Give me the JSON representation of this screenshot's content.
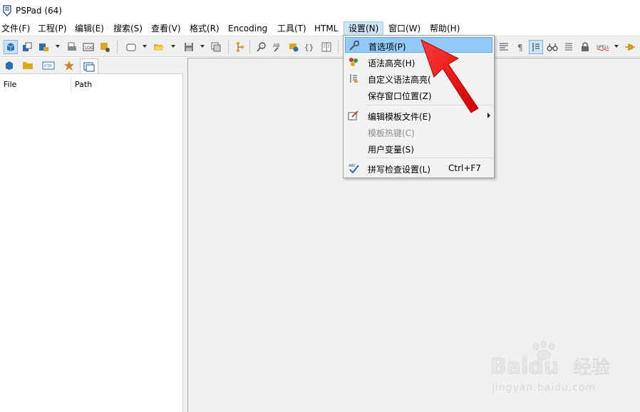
{
  "window": {
    "title": "PSPad (64)"
  },
  "menubar": {
    "items": [
      {
        "label": "文件(F)"
      },
      {
        "label": "工程(P)"
      },
      {
        "label": "编辑(E)"
      },
      {
        "label": "搜索(S)"
      },
      {
        "label": "查看(V)"
      },
      {
        "label": "格式(R)"
      },
      {
        "label": "Encoding"
      },
      {
        "label": "工具(T)"
      },
      {
        "label": "HTML"
      },
      {
        "label": "设置(N)",
        "active": true
      },
      {
        "label": "窗口(W)"
      },
      {
        "label": "帮助(H)"
      }
    ]
  },
  "toolbar": {
    "buttons": [
      "new-project-icon",
      "open-project-icon",
      "save-project-icon",
      "print-icon",
      "log-icon",
      "config-icon",
      "new-file-icon",
      "open-folder-icon",
      "save-icon",
      "copy-window-icon",
      "tree-icon",
      "find-icon",
      "replace-icon",
      "browse-icon",
      "braces-icon",
      "columns-icon",
      "format-lines-icon",
      "pilcrow-icon",
      "block-select-icon",
      "binoculars-icon",
      "list-icon",
      "lock-icon",
      "spell-icon",
      "pin-icon"
    ]
  },
  "left_panel": {
    "tabs": [
      "project-icon",
      "folder-icon",
      "ftp-icon",
      "favorites-icon",
      "windows-icon"
    ],
    "columns": {
      "file": "File",
      "path": "Path"
    }
  },
  "settings_menu": {
    "items": [
      {
        "label": "首选项(P)",
        "icon": "wrench-icon",
        "highlighted": true
      },
      {
        "label": "语法高亮(H)",
        "icon": "highlight-icon"
      },
      {
        "label": "自定义语法高亮(",
        "icon": "custom-highlight-icon"
      },
      {
        "label": "保存窗口位置(Z)"
      },
      {
        "label": "编辑模板文件(E)",
        "icon": "edit-template-icon",
        "submenu": true
      },
      {
        "label": "模板热键(C)",
        "disabled": true
      },
      {
        "label": "用户变量(S)"
      },
      {
        "label": "拼写检查设置(L)",
        "icon": "spellcheck-icon",
        "shortcut": "Ctrl+F7"
      }
    ]
  },
  "watermark": {
    "brand": "Baidu",
    "brand_cn": "经验",
    "url": "jingyan.baidu.com"
  },
  "colors": {
    "highlight": "#91c9f7",
    "menu_active": "#cce4f7",
    "arrow": "#ee1111",
    "accent": "#1c75bc"
  }
}
